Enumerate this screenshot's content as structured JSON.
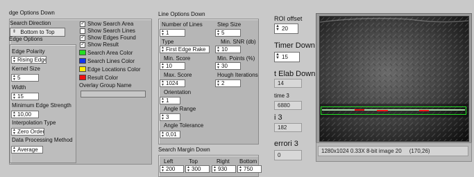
{
  "edge_options_down": {
    "title": "dge Options Down",
    "search_direction_label": "Search Direction",
    "search_direction_value": "Bottom to Top",
    "edge_options_label": "Edge Options",
    "edge_polarity_label": "Edge Polarity",
    "edge_polarity_value": "Rising Edges",
    "kernel_size_label": "Kernel Size",
    "kernel_size_value": "5",
    "width_label": "Width",
    "width_value": "15",
    "min_edge_strength_label": "Minimum Edge Strength",
    "min_edge_strength_value": "10,00",
    "interpolation_label": "Interpolation Type",
    "interpolation_value": "Zero Order",
    "data_processing_label": "Data Processing Method",
    "data_processing_value": "Average"
  },
  "overlay": {
    "show_search_area": "Show Search Area",
    "show_search_lines": "Show Search Lines",
    "show_edges_found": "Show Edges Found",
    "show_result": "Show Result",
    "search_area_color": "Search Area Color",
    "search_lines_color": "Search Lines Color",
    "edge_locations_color": "Edge Locations Color",
    "result_color": "Result Color",
    "overlay_group_name": "Overlay Group Name",
    "overlay_group_value": "",
    "colors": {
      "search_area": "#22dd22",
      "search_lines": "#1133ee",
      "edge_locations": "#ffee00",
      "result": "#ee1111"
    }
  },
  "line_options_down": {
    "title": "Line Options Down",
    "number_of_lines_label": "Number of Lines",
    "number_of_lines_value": "1",
    "step_size_label": "Step Size",
    "step_size_value": "5",
    "type_label": "Type",
    "type_value": "First Edge Rake",
    "min_snr_label": "Min. SNR (db)",
    "min_snr_value": "10",
    "min_score_label": "Min. Score",
    "min_score_value": "10",
    "min_points_label": "Min. Points (%)",
    "min_points_value": "30",
    "max_score_label": "Max. Score",
    "max_score_value": "1024",
    "hough_iterations_label": "Hough Iterations",
    "hough_iterations_value": "2",
    "orientation_label": "Orientation",
    "orientation_value": "1",
    "angle_range_label": "Angle Range",
    "angle_range_value": "3",
    "angle_tolerance_label": "Angle Tolerance",
    "angle_tolerance_value": "0,01"
  },
  "search_margin_down": {
    "title": "Search Margin Down",
    "left_label": "Left",
    "top_label": "Top",
    "right_label": "Right",
    "bottom_label": "Bottom",
    "left_value": "200",
    "top_value": "300",
    "right_value": "930",
    "bottom_value": "750"
  },
  "indicators": {
    "roi_offset_label": "ROI offset",
    "roi_offset_value": "20",
    "timer_down_label": "Timer Down",
    "timer_down_value": "15",
    "elab_down_label": "t Elab Down",
    "elab_down_value": "14",
    "time3_label": "time 3",
    "time3_value": "6880",
    "i3_label": "i 3",
    "i3_value": "182",
    "errori3_label": "errori 3",
    "errori3_value": "0"
  },
  "image_display": {
    "status_text": "1280x1024 0.33X 8-bit image 20     (170,26)"
  }
}
